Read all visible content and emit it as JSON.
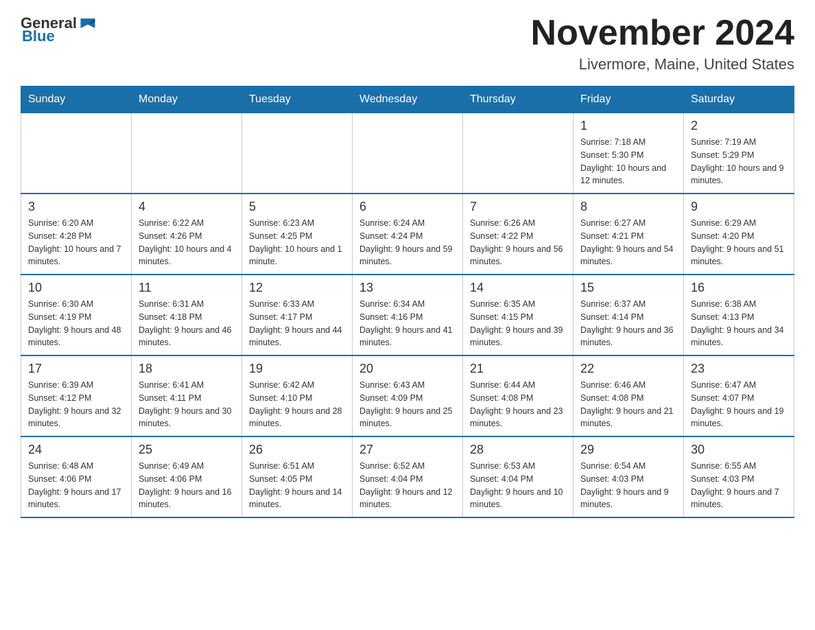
{
  "logo": {
    "general": "General",
    "blue": "Blue"
  },
  "title": "November 2024",
  "subtitle": "Livermore, Maine, United States",
  "days_of_week": [
    "Sunday",
    "Monday",
    "Tuesday",
    "Wednesday",
    "Thursday",
    "Friday",
    "Saturday"
  ],
  "weeks": [
    [
      {
        "day": "",
        "info": ""
      },
      {
        "day": "",
        "info": ""
      },
      {
        "day": "",
        "info": ""
      },
      {
        "day": "",
        "info": ""
      },
      {
        "day": "",
        "info": ""
      },
      {
        "day": "1",
        "info": "Sunrise: 7:18 AM\nSunset: 5:30 PM\nDaylight: 10 hours and 12 minutes."
      },
      {
        "day": "2",
        "info": "Sunrise: 7:19 AM\nSunset: 5:29 PM\nDaylight: 10 hours and 9 minutes."
      }
    ],
    [
      {
        "day": "3",
        "info": "Sunrise: 6:20 AM\nSunset: 4:28 PM\nDaylight: 10 hours and 7 minutes."
      },
      {
        "day": "4",
        "info": "Sunrise: 6:22 AM\nSunset: 4:26 PM\nDaylight: 10 hours and 4 minutes."
      },
      {
        "day": "5",
        "info": "Sunrise: 6:23 AM\nSunset: 4:25 PM\nDaylight: 10 hours and 1 minute."
      },
      {
        "day": "6",
        "info": "Sunrise: 6:24 AM\nSunset: 4:24 PM\nDaylight: 9 hours and 59 minutes."
      },
      {
        "day": "7",
        "info": "Sunrise: 6:26 AM\nSunset: 4:22 PM\nDaylight: 9 hours and 56 minutes."
      },
      {
        "day": "8",
        "info": "Sunrise: 6:27 AM\nSunset: 4:21 PM\nDaylight: 9 hours and 54 minutes."
      },
      {
        "day": "9",
        "info": "Sunrise: 6:29 AM\nSunset: 4:20 PM\nDaylight: 9 hours and 51 minutes."
      }
    ],
    [
      {
        "day": "10",
        "info": "Sunrise: 6:30 AM\nSunset: 4:19 PM\nDaylight: 9 hours and 48 minutes."
      },
      {
        "day": "11",
        "info": "Sunrise: 6:31 AM\nSunset: 4:18 PM\nDaylight: 9 hours and 46 minutes."
      },
      {
        "day": "12",
        "info": "Sunrise: 6:33 AM\nSunset: 4:17 PM\nDaylight: 9 hours and 44 minutes."
      },
      {
        "day": "13",
        "info": "Sunrise: 6:34 AM\nSunset: 4:16 PM\nDaylight: 9 hours and 41 minutes."
      },
      {
        "day": "14",
        "info": "Sunrise: 6:35 AM\nSunset: 4:15 PM\nDaylight: 9 hours and 39 minutes."
      },
      {
        "day": "15",
        "info": "Sunrise: 6:37 AM\nSunset: 4:14 PM\nDaylight: 9 hours and 36 minutes."
      },
      {
        "day": "16",
        "info": "Sunrise: 6:38 AM\nSunset: 4:13 PM\nDaylight: 9 hours and 34 minutes."
      }
    ],
    [
      {
        "day": "17",
        "info": "Sunrise: 6:39 AM\nSunset: 4:12 PM\nDaylight: 9 hours and 32 minutes."
      },
      {
        "day": "18",
        "info": "Sunrise: 6:41 AM\nSunset: 4:11 PM\nDaylight: 9 hours and 30 minutes."
      },
      {
        "day": "19",
        "info": "Sunrise: 6:42 AM\nSunset: 4:10 PM\nDaylight: 9 hours and 28 minutes."
      },
      {
        "day": "20",
        "info": "Sunrise: 6:43 AM\nSunset: 4:09 PM\nDaylight: 9 hours and 25 minutes."
      },
      {
        "day": "21",
        "info": "Sunrise: 6:44 AM\nSunset: 4:08 PM\nDaylight: 9 hours and 23 minutes."
      },
      {
        "day": "22",
        "info": "Sunrise: 6:46 AM\nSunset: 4:08 PM\nDaylight: 9 hours and 21 minutes."
      },
      {
        "day": "23",
        "info": "Sunrise: 6:47 AM\nSunset: 4:07 PM\nDaylight: 9 hours and 19 minutes."
      }
    ],
    [
      {
        "day": "24",
        "info": "Sunrise: 6:48 AM\nSunset: 4:06 PM\nDaylight: 9 hours and 17 minutes."
      },
      {
        "day": "25",
        "info": "Sunrise: 6:49 AM\nSunset: 4:06 PM\nDaylight: 9 hours and 16 minutes."
      },
      {
        "day": "26",
        "info": "Sunrise: 6:51 AM\nSunset: 4:05 PM\nDaylight: 9 hours and 14 minutes."
      },
      {
        "day": "27",
        "info": "Sunrise: 6:52 AM\nSunset: 4:04 PM\nDaylight: 9 hours and 12 minutes."
      },
      {
        "day": "28",
        "info": "Sunrise: 6:53 AM\nSunset: 4:04 PM\nDaylight: 9 hours and 10 minutes."
      },
      {
        "day": "29",
        "info": "Sunrise: 6:54 AM\nSunset: 4:03 PM\nDaylight: 9 hours and 9 minutes."
      },
      {
        "day": "30",
        "info": "Sunrise: 6:55 AM\nSunset: 4:03 PM\nDaylight: 9 hours and 7 minutes."
      }
    ]
  ]
}
